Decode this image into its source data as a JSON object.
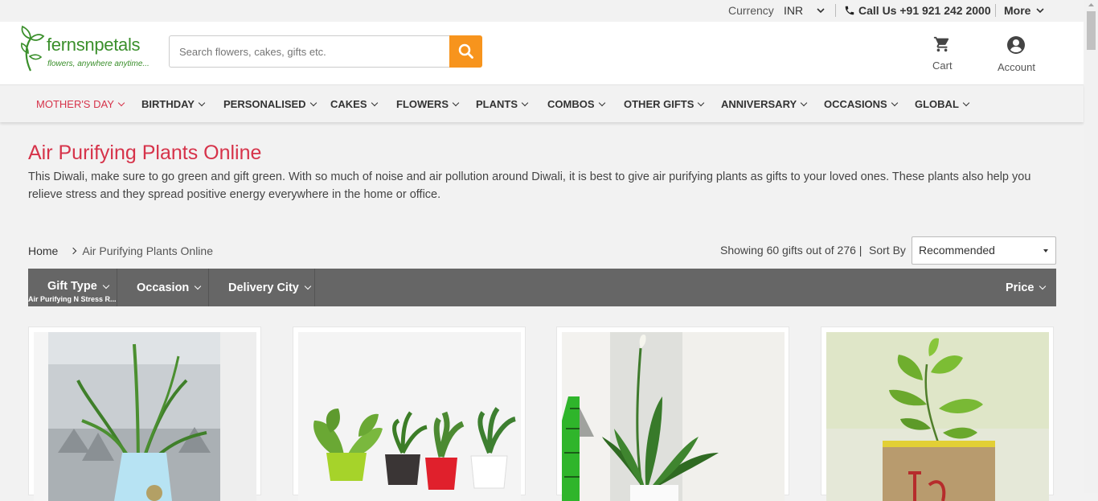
{
  "topbar": {
    "currency_label": "Currency",
    "currency_value": "INR",
    "call_label": "Call Us +91 921 242 2000",
    "more_label": "More"
  },
  "header": {
    "logo_text": "fernsnpetals",
    "logo_tagline": "flowers, anywhere anytime...",
    "search_placeholder": "Search flowers, cakes, gifts etc.",
    "cart_label": "Cart",
    "account_label": "Account"
  },
  "nav": {
    "items": [
      {
        "label": "MOTHER'S DAY"
      },
      {
        "label": "BIRTHDAY"
      },
      {
        "label": "PERSONALISED"
      },
      {
        "label": "CAKES"
      },
      {
        "label": "FLOWERS"
      },
      {
        "label": "PLANTS"
      },
      {
        "label": "COMBOS"
      },
      {
        "label": "OTHER GIFTS"
      },
      {
        "label": "ANNIVERSARY"
      },
      {
        "label": "OCCASIONS"
      },
      {
        "label": "GLOBAL"
      }
    ]
  },
  "main": {
    "title": "Air Purifying Plants Online",
    "description": "This Diwali, make sure to go green and gift green. With so much of noise and air pollution around Diwali, it is best to give air purifying plants as gifts to your loved ones. These plants also help you relieve stress and they spread positive energy everywhere in the home or office.",
    "breadcrumb": {
      "home": "Home",
      "current": "Air Purifying Plants Online"
    },
    "showing": "Showing 60 gifts out of 276 |",
    "sort_label": "Sort By",
    "sort_value": "Recommended"
  },
  "filters": {
    "gift_type": "Gift Type",
    "gift_type_sub": "Air Purifying N Stress R...",
    "occasion": "Occasion",
    "delivery_city": "Delivery City",
    "price": "Price"
  },
  "colors": {
    "brand_red": "#d6334a",
    "brand_green": "#3a8f2b",
    "search_orange": "#f7941d",
    "filter_bar": "#666666"
  }
}
